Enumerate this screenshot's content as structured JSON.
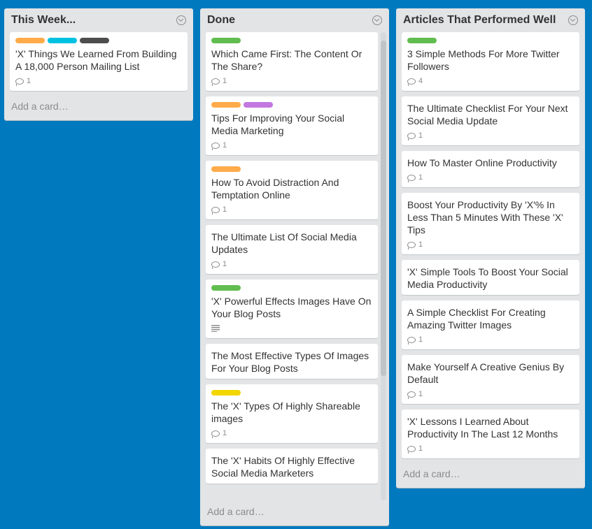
{
  "board": {
    "lists": [
      {
        "title": "This Week...",
        "add_card": "Add a card…",
        "cards": [
          {
            "labels": [
              "orange",
              "sky",
              "black"
            ],
            "title": "'X' Things We Learned From Building A 18,000 Person Mailing List",
            "comments": "1"
          }
        ]
      },
      {
        "title": "Done",
        "add_card": "Add a card…",
        "cards": [
          {
            "labels": [
              "green"
            ],
            "title": "Which Came First: The Content Or The Share?",
            "comments": "1"
          },
          {
            "labels": [
              "orange",
              "purple"
            ],
            "title": "Tips For Improving Your Social Media Marketing",
            "comments": "1"
          },
          {
            "labels": [
              "orange"
            ],
            "title": "How To Avoid Distraction And Temptation Online",
            "comments": "1"
          },
          {
            "labels": [],
            "title": "The Ultimate List Of Social Media Updates",
            "comments": "1"
          },
          {
            "labels": [
              "green"
            ],
            "title": "'X' Powerful Effects Images Have On Your Blog Posts",
            "comments": null,
            "description": true
          },
          {
            "labels": [],
            "title": "The Most Effective Types Of Images For Your Blog Posts",
            "comments": null
          },
          {
            "labels": [
              "yellow"
            ],
            "title": "The 'X' Types Of Highly Shareable images",
            "comments": "1"
          },
          {
            "labels": [],
            "title": "The 'X' Habits Of Highly Effective Social Media Marketers",
            "comments": null
          }
        ]
      },
      {
        "title": "Articles That Performed Well",
        "add_card": "Add a card…",
        "cards": [
          {
            "labels": [
              "green"
            ],
            "title": "3 Simple Methods For More Twitter Followers",
            "comments": "4"
          },
          {
            "labels": [],
            "title": "The Ultimate Checklist For Your Next Social Media Update",
            "comments": "1"
          },
          {
            "labels": [],
            "title": "How To Master Online Productivity",
            "comments": "1"
          },
          {
            "labels": [],
            "title": "Boost Your Productivity By 'X'% In Less Than 5 Minutes With These 'X' Tips",
            "comments": "1"
          },
          {
            "labels": [],
            "title": "'X' Simple Tools To Boost Your Social Media Productivity",
            "comments": null
          },
          {
            "labels": [],
            "title": "A Simple Checklist For Creating Amazing Twitter Images",
            "comments": "1"
          },
          {
            "labels": [],
            "title": "Make Yourself A Creative Genius By Default",
            "comments": "1"
          },
          {
            "labels": [],
            "title": "'X' Lessons I Learned About Productivity In The Last 12 Months",
            "comments": "1"
          }
        ]
      }
    ]
  },
  "colors": {
    "background": "#0079bf",
    "list_bg": "#e2e4e6",
    "label_green": "#61bd4f",
    "label_orange": "#ffab4a",
    "label_sky": "#00c2e0",
    "label_black": "#4d4d4d",
    "label_purple": "#c377e0",
    "label_yellow": "#f2d600"
  },
  "icons": {
    "list_menu": "chevron-circle-down-icon",
    "comment": "speech-bubble-icon",
    "description": "text-lines-icon"
  }
}
